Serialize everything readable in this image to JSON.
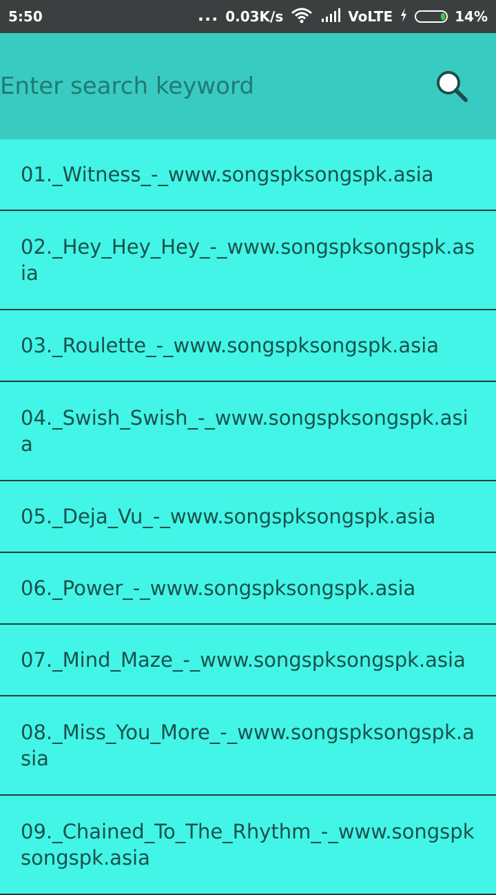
{
  "status_bar": {
    "time": "5:50",
    "dots": "...",
    "speed": "0.03K/s",
    "network": "VoLTE",
    "battery": "14%",
    "icons": [
      "wifi-icon",
      "signal-icon",
      "charging-icon",
      "battery-icon"
    ]
  },
  "search": {
    "placeholder": "Enter search keyword",
    "value": "",
    "icon": "search-icon"
  },
  "songs": [
    {
      "title": "01._Witness_-_www.songspksongspk.asia"
    },
    {
      "title": "02._Hey_Hey_Hey_-_www.songspksongspk.asia"
    },
    {
      "title": "03._Roulette_-_www.songspksongspk.asia"
    },
    {
      "title": "04._Swish_Swish_-_www.songspksongspk.asia"
    },
    {
      "title": "05._Deja_Vu_-_www.songspksongspk.asia"
    },
    {
      "title": "06._Power_-_www.songspksongspk.asia"
    },
    {
      "title": "07._Mind_Maze_-_www.songspksongspk.asia"
    },
    {
      "title": "08._Miss_You_More_-_www.songspksongspk.asia"
    },
    {
      "title": "09._Chained_To_The_Rhythm_-_www.songspksongspk.asia"
    }
  ],
  "colors": {
    "status_bar": "#3c3f40",
    "search_bar": "#39cbc2",
    "list_background": "#42f5e7",
    "list_text": "#1a514b",
    "divider": "#1f3d3a"
  }
}
